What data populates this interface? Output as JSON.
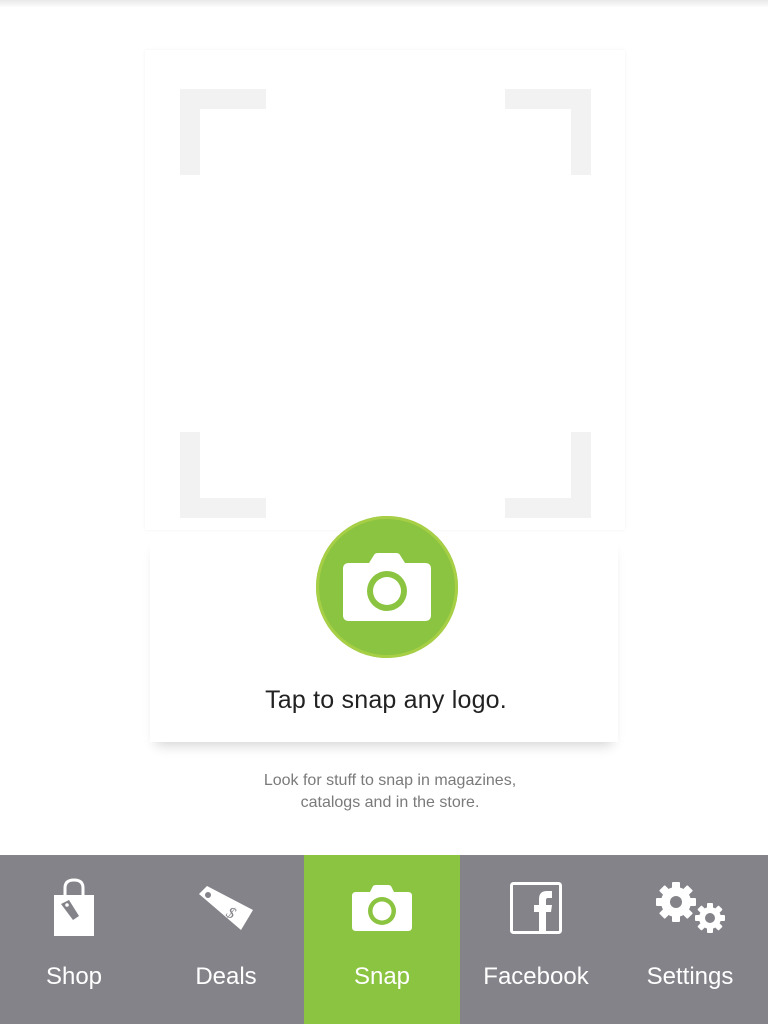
{
  "main": {
    "tap_text": "Tap to snap any logo.",
    "hint_line1": "Look for stuff to snap in magazines,",
    "hint_line2": "catalogs and in the store.",
    "snap_button_icon": "camera-icon"
  },
  "tabbar": {
    "tabs": [
      {
        "label": "Shop",
        "icon": "shopping-bag-icon",
        "active": false
      },
      {
        "label": "Deals",
        "icon": "price-tag-icon",
        "active": false
      },
      {
        "label": "Snap",
        "icon": "camera-icon",
        "active": true
      },
      {
        "label": "Facebook",
        "icon": "facebook-icon",
        "active": false
      },
      {
        "label": "Settings",
        "icon": "gears-icon",
        "active": false
      }
    ]
  },
  "colors": {
    "accent": "#8bc441",
    "tabbar_background": "#848389",
    "text": "#222222",
    "hint_text": "#7a7a7a"
  }
}
